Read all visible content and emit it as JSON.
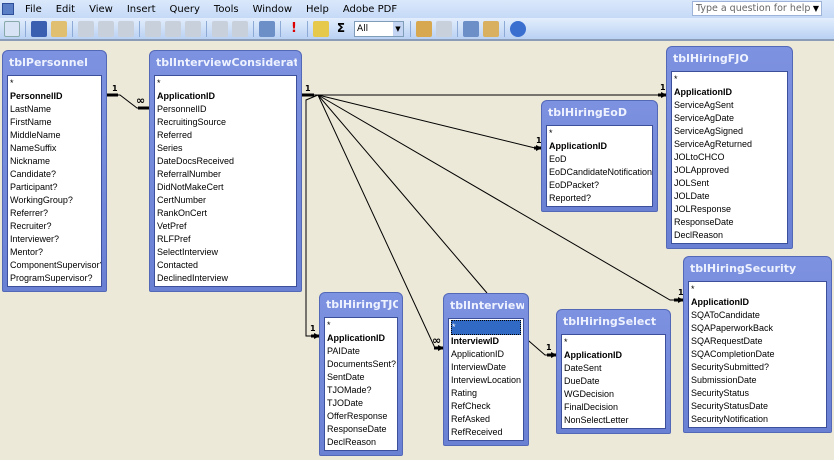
{
  "menu": [
    "File",
    "Edit",
    "View",
    "Insert",
    "Query",
    "Tools",
    "Window",
    "Help",
    "Adobe PDF"
  ],
  "help_placeholder": "Type a question for help",
  "toolbar": {
    "combo_value": "All",
    "sigma": "Σ"
  },
  "relationship_labels": {
    "one": "1",
    "many": "∞"
  },
  "tables": {
    "personnel": {
      "name": "tblPersonnel",
      "fields": [
        "*",
        "PersonnelID",
        "LastName",
        "FirstName",
        "MiddleName",
        "NameSuffix",
        "Nickname",
        "Candidate?",
        "Participant?",
        "WorkingGroup?",
        "Referrer?",
        "Recruiter?",
        "Interviewer?",
        "Mentor?",
        "ComponentSupervisor?",
        "ProgramSupervisor?"
      ]
    },
    "interview_consideration": {
      "name": "tblInterviewConsideration",
      "fields": [
        "*",
        "ApplicationID",
        "PersonnelID",
        "RecruitingSource",
        "Referred",
        "Series",
        "DateDocsReceived",
        "ReferralNumber",
        "DidNotMakeCert",
        "CertNumber",
        "RankOnCert",
        "VetPref",
        "RLFPref",
        "SelectInterview",
        "Contacted",
        "DeclinedInterview"
      ]
    },
    "hiring_eod": {
      "name": "tblHiringEoD",
      "fields": [
        "*",
        "ApplicationID",
        "EoD",
        "EoDCandidateNotification",
        "EoDPacket?",
        "Reported?"
      ]
    },
    "hiring_fjo": {
      "name": "tblHiringFJO",
      "fields": [
        "*",
        "ApplicationID",
        "ServiceAgSent",
        "ServiceAgDate",
        "ServiceAgSigned",
        "ServiceAgReturned",
        "JOLtoCHCO",
        "JOLApproved",
        "JOLSent",
        "JOLDate",
        "JOLResponse",
        "ResponseDate",
        "DeclReason"
      ]
    },
    "hiring_tjo": {
      "name": "tblHiringTJO",
      "fields": [
        "*",
        "ApplicationID",
        "PAIDate",
        "DocumentsSent?",
        "SentDate",
        "TJOMade?",
        "TJODate",
        "OfferResponse",
        "ResponseDate",
        "DeclReason"
      ]
    },
    "interviews": {
      "name": "tblInterviews",
      "fields": [
        "*",
        "InterviewID",
        "ApplicationID",
        "InterviewDate",
        "InterviewLocation",
        "Rating",
        "RefCheck",
        "RefAsked",
        "RefReceived"
      ]
    },
    "hiring_select": {
      "name": "tblHiringSelect",
      "fields": [
        "*",
        "ApplicationID",
        "DateSent",
        "DueDate",
        "WGDecision",
        "FinalDecision",
        "NonSelectLetter"
      ]
    },
    "hiring_security": {
      "name": "tblHiringSecurity",
      "fields": [
        "*",
        "ApplicationID",
        "SQAToCandidate",
        "SQAPaperworkBack",
        "SQARequestDate",
        "SQACompletionDate",
        "SecuritySubmitted?",
        "SubmissionDate",
        "SecurityStatus",
        "SecurityStatusDate",
        "SecurityNotification"
      ]
    }
  },
  "colors": {
    "title_bar": "#6a80d3",
    "selected_field": "#316ac5",
    "canvas": "#ece9d8"
  }
}
